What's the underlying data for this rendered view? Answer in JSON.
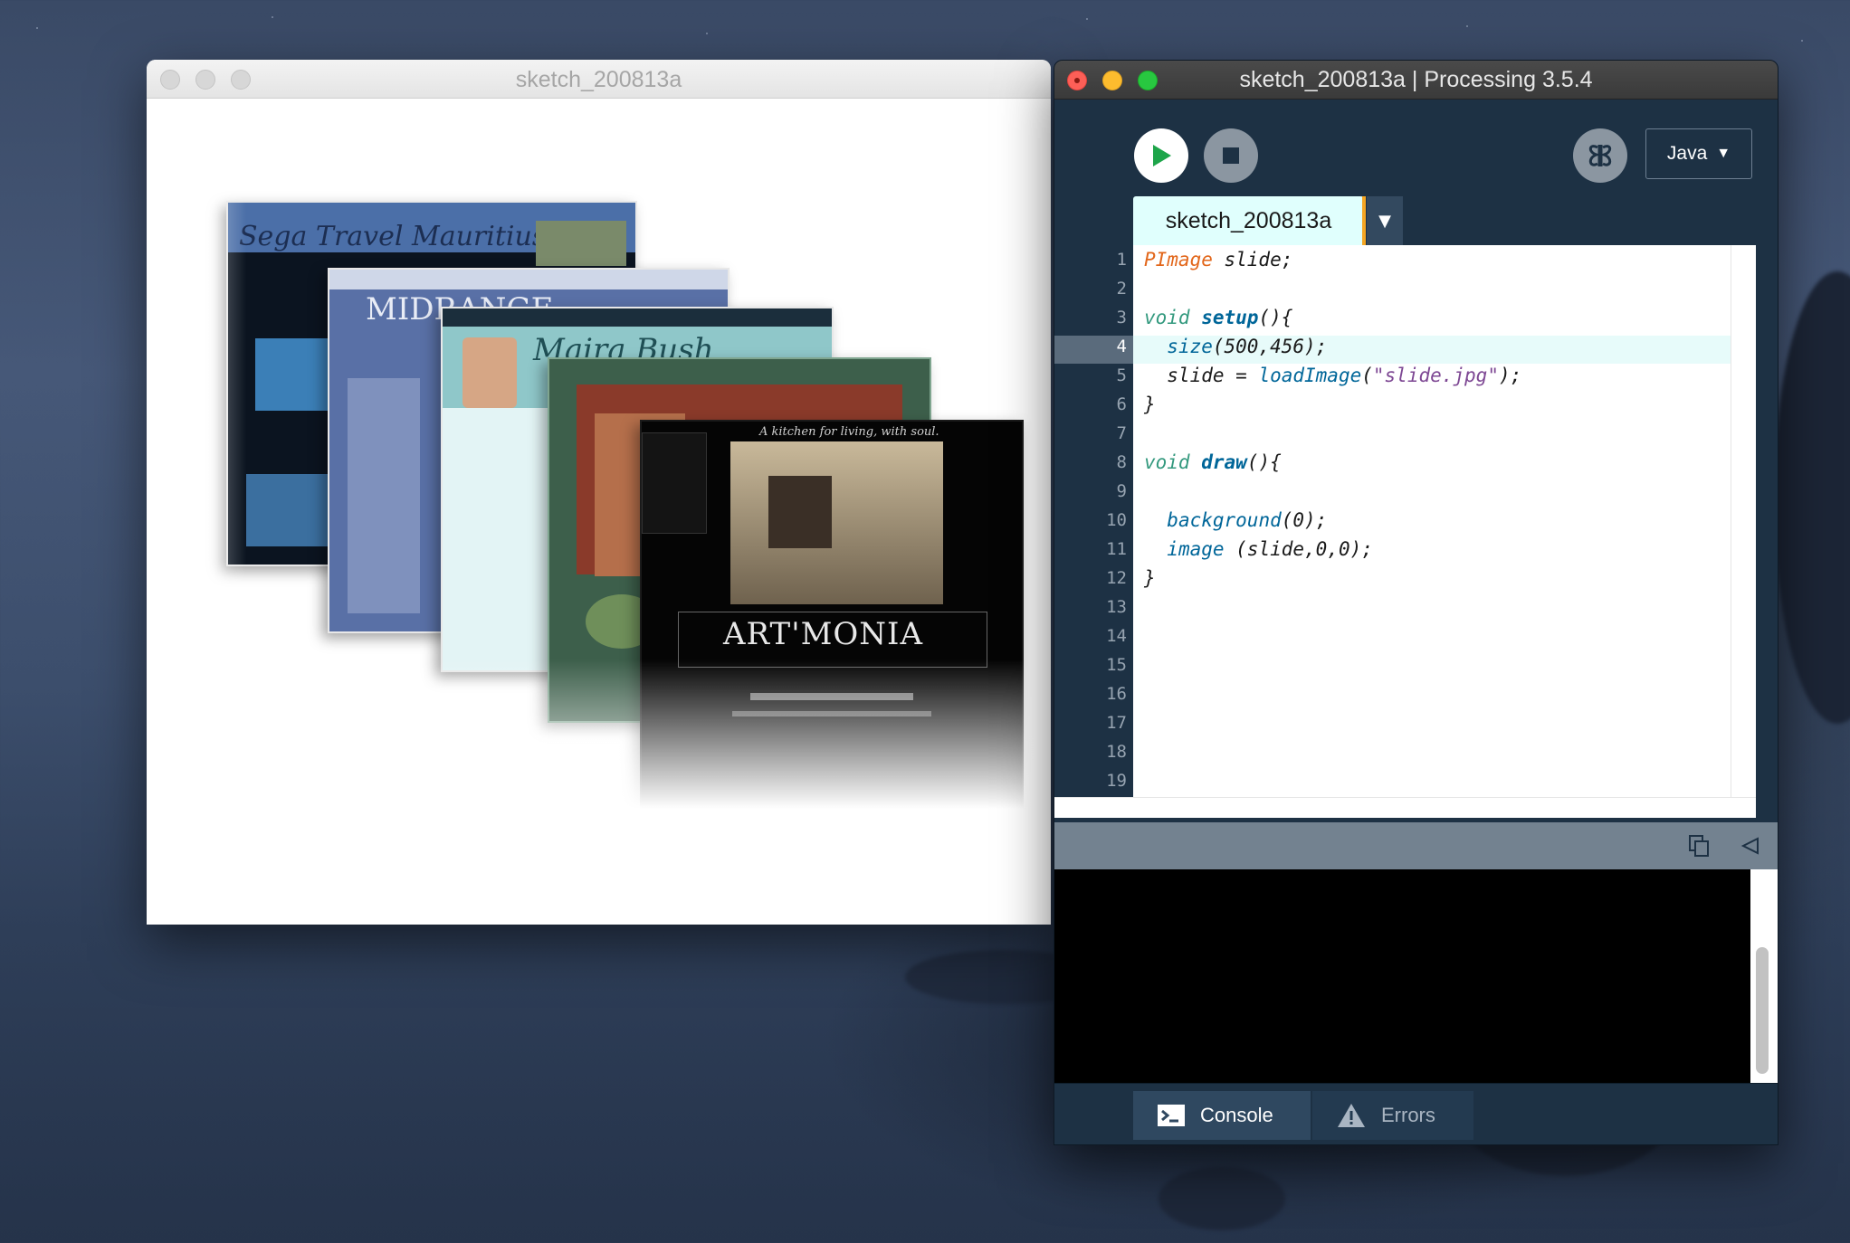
{
  "sketch_window": {
    "title": "sketch_200813a",
    "slides": [
      {
        "title": "Sega Travel Mauritius"
      },
      {
        "title": "MIDRANGE"
      },
      {
        "title": "Maira Bush"
      },
      {
        "title": "A kitchen for living, with soul."
      },
      {
        "title": "ART'MONIA"
      }
    ]
  },
  "ide_window": {
    "title": "sketch_200813a | Processing 3.5.4",
    "toolbar": {
      "run_icon": "play-icon",
      "stop_icon": "stop-icon",
      "debug_icon": "debug-butterfly-icon",
      "mode_label": "Java",
      "mode_arrow": "▼"
    },
    "tab": {
      "label": "sketch_200813a",
      "menu_arrow": "▼"
    },
    "editor": {
      "current_line": 4,
      "line_numbers": [
        "1",
        "2",
        "3",
        "4",
        "5",
        "6",
        "7",
        "8",
        "9",
        "10",
        "11",
        "12",
        "13",
        "14",
        "15",
        "16",
        "17",
        "18",
        "19"
      ],
      "code": [
        "PImage slide;",
        "",
        "void setup(){",
        "  size(500,456);",
        "  slide = loadImage(\"slide.jpg\");",
        "}",
        "",
        "void draw(){",
        "",
        "  background(0);",
        "  image (slide,0,0);",
        "}"
      ]
    },
    "console": {
      "copy_icon": "copy-icon",
      "collapse_icon": "triangle-left-icon"
    },
    "footer": {
      "console_label": "Console",
      "console_icon": "terminal-icon",
      "errors_label": "Errors",
      "errors_icon": "warning-icon"
    }
  }
}
